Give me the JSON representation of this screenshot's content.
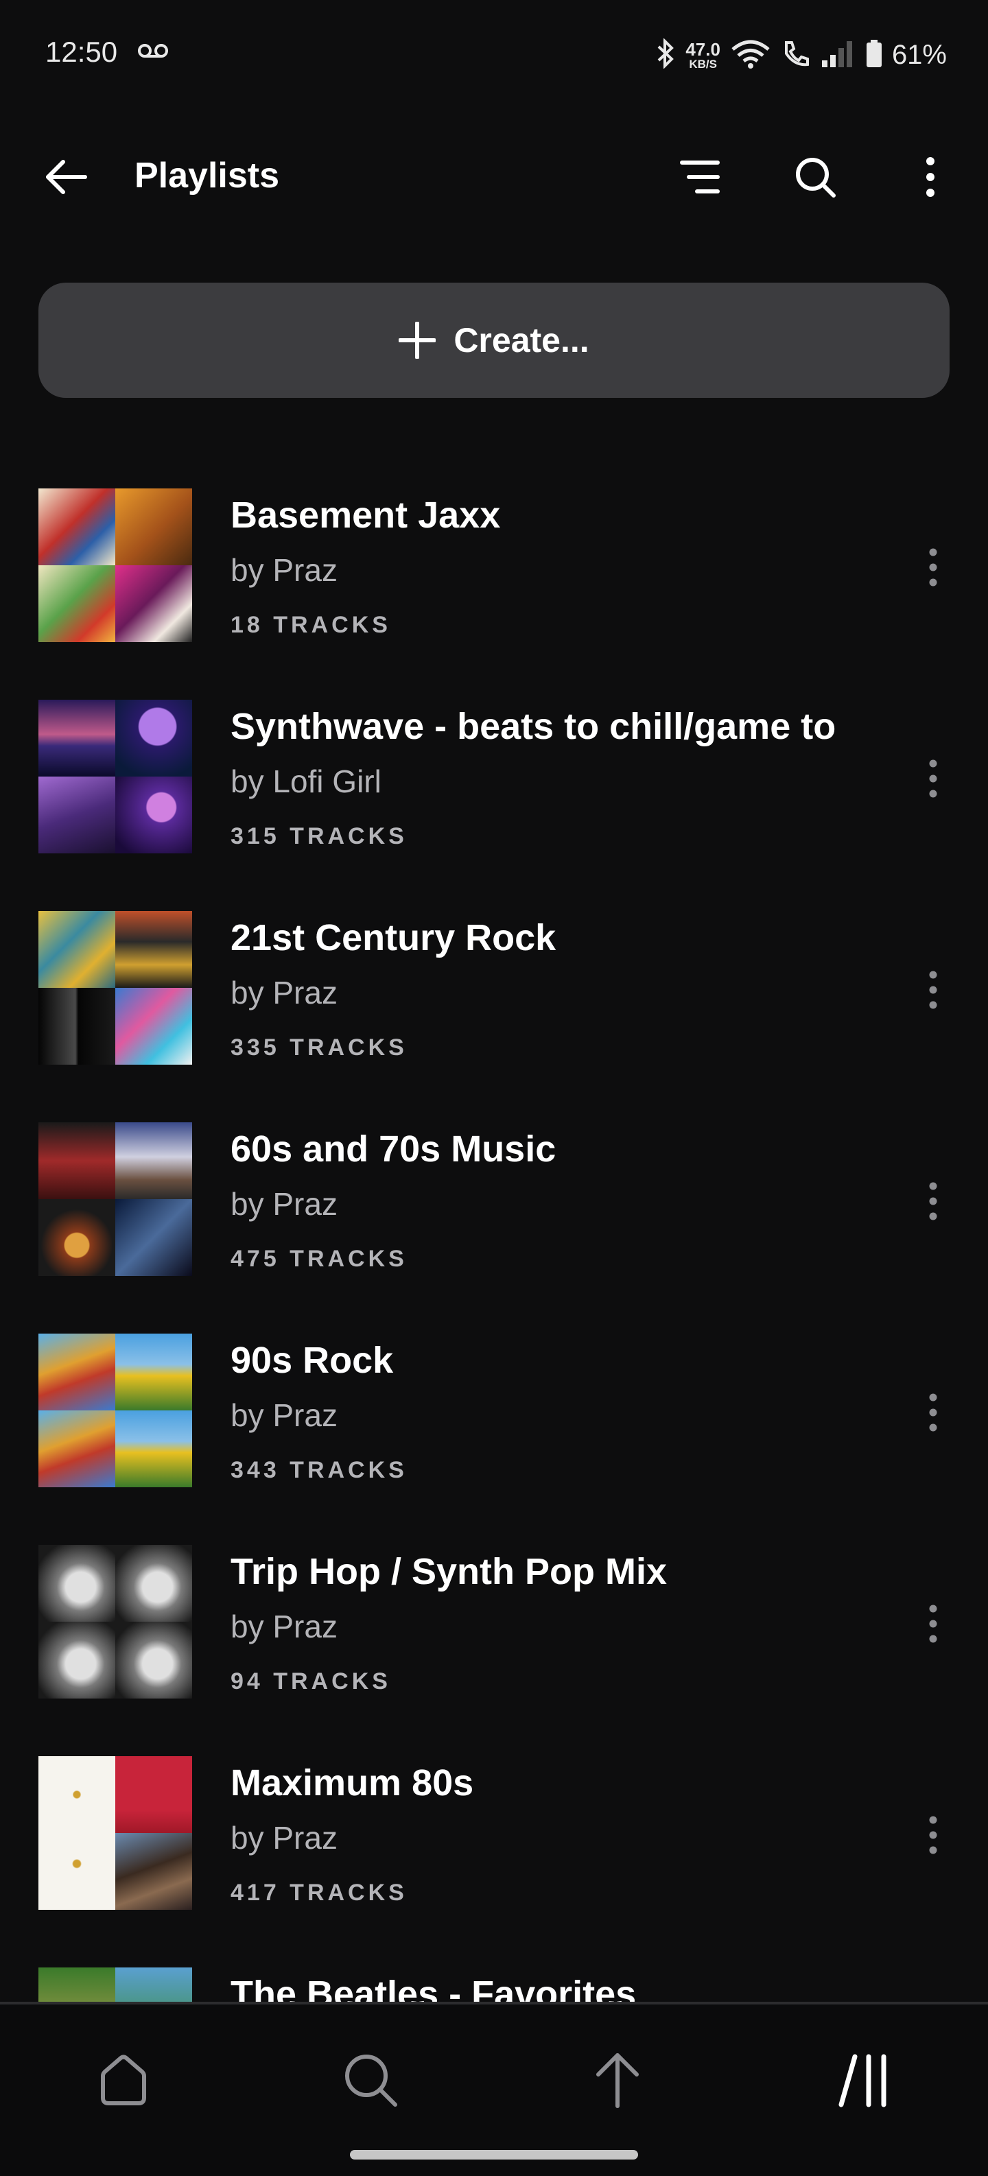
{
  "status_bar": {
    "time": "12:50",
    "net_speed": "47.0",
    "net_unit": "KB/S",
    "battery": "61%"
  },
  "header": {
    "title": "Playlists",
    "icons": [
      "back-arrow-icon",
      "sort-icon",
      "search-icon",
      "more-vert-icon"
    ]
  },
  "create": {
    "label": "Create..."
  },
  "playlists": [
    {
      "name": "Basement Jaxx",
      "owner": "by Praz",
      "tracks": "18 TRACKS"
    },
    {
      "name": "Synthwave - beats to chill/game to",
      "owner": "by Lofi Girl",
      "tracks": "315 TRACKS"
    },
    {
      "name": "21st Century Rock",
      "owner": "by Praz",
      "tracks": "335 TRACKS"
    },
    {
      "name": "60s and 70s Music",
      "owner": "by Praz",
      "tracks": "475 TRACKS"
    },
    {
      "name": "90s Rock",
      "owner": "by Praz",
      "tracks": "343 TRACKS"
    },
    {
      "name": "Trip Hop / Synth Pop Mix",
      "owner": "by Praz",
      "tracks": "94 TRACKS"
    },
    {
      "name": "Maximum 80s",
      "owner": "by Praz",
      "tracks": "417 TRACKS"
    },
    {
      "name": "The Beatles - Favorites",
      "owner": "",
      "tracks": ""
    }
  ],
  "bottom_nav": {
    "icons": [
      "home-icon",
      "search-icon",
      "upload-arrow-icon",
      "library-icon"
    ]
  },
  "colors": {
    "background": "#0d0d0e",
    "create_button": "#3c3c3f",
    "secondary_text": "#b4b4b8"
  }
}
